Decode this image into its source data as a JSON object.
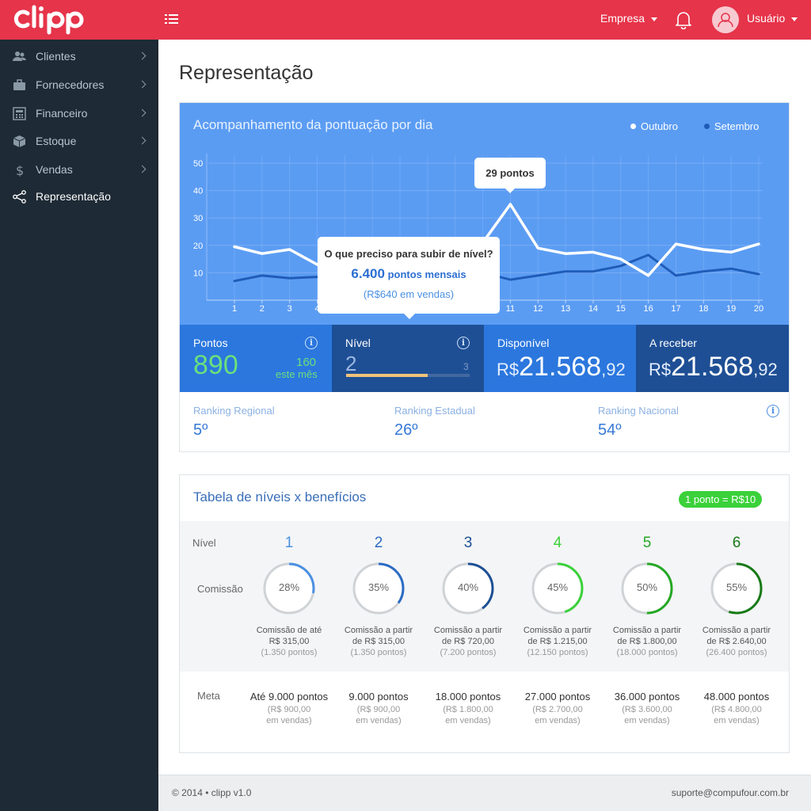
{
  "app": {
    "logo_text": "clipp"
  },
  "header": {
    "company_label": "Empresa",
    "user_label": "Usuário"
  },
  "sidebar": {
    "items": [
      {
        "label": "Clientes",
        "icon": "users-icon"
      },
      {
        "label": "Fornecedores",
        "icon": "briefcase-icon"
      },
      {
        "label": "Financeiro",
        "icon": "calculator-icon"
      },
      {
        "label": "Estoque",
        "icon": "box-icon"
      },
      {
        "label": "Vendas",
        "icon": "dollar-icon"
      },
      {
        "label": "Representação",
        "icon": "share-icon",
        "active": true
      }
    ]
  },
  "main": {
    "title": "Representação"
  },
  "chart_section": {
    "title": "Acompanhamento da pontuação por dia",
    "legend": [
      {
        "name": "Outubro",
        "color": "#ffffff"
      },
      {
        "name": "Setembro",
        "color": "#1f5cb8"
      }
    ],
    "tooltip_small": "29 pontos",
    "tooltip_big": {
      "question": "O que preciso para subir de nível?",
      "points_value": "6.400",
      "points_label": "pontos mensais",
      "sales": "(R$640 em vendas)"
    }
  },
  "chart_data": {
    "type": "line",
    "x": [
      1,
      2,
      3,
      4,
      5,
      6,
      7,
      8,
      9,
      10,
      11,
      12,
      13,
      14,
      15,
      16,
      17,
      18,
      19,
      20
    ],
    "ylim": [
      0,
      55
    ],
    "yticks": [
      10,
      20,
      30,
      40,
      50
    ],
    "series": [
      {
        "name": "Outubro",
        "color": "#ffffff",
        "values": [
          19.5,
          17,
          18.5,
          13,
          12,
          15,
          14,
          16,
          17,
          21,
          35,
          19,
          17,
          17.5,
          15,
          9,
          20.5,
          18.5,
          17.5,
          20.5
        ]
      },
      {
        "name": "Setembro",
        "color": "#1f5cb8",
        "values": [
          7,
          9,
          8,
          8.5,
          9,
          9.5,
          10,
          9,
          9.5,
          10,
          7.5,
          9,
          10.5,
          10.5,
          12.5,
          16.5,
          9,
          10.5,
          11.5,
          9.5
        ]
      }
    ]
  },
  "stats": {
    "pontos": {
      "title": "Pontos",
      "value": "890",
      "month_value": "160",
      "month_label": "este mês"
    },
    "nivel": {
      "title": "Nível",
      "value": "2",
      "max": "3",
      "progress": 0.66
    },
    "disponivel": {
      "title": "Disponível",
      "currency": "R$",
      "int": "21.568",
      "dec": ",92"
    },
    "a_receber": {
      "title": "A receber",
      "currency": "R$",
      "int": "21.568",
      "dec": ",92"
    }
  },
  "rankings": [
    {
      "label": "Ranking Regional",
      "value": "5º"
    },
    {
      "label": "Ranking Estadual",
      "value": "26º"
    },
    {
      "label": "Ranking Nacional",
      "value": "54º"
    }
  ],
  "levels_table": {
    "title": "Tabela de níveis x benefícios",
    "badge": "1 ponto = R$10",
    "row_labels": {
      "level": "Nível",
      "commission": "Comissão",
      "goal": "Meta"
    },
    "levels": [
      {
        "level": "1",
        "color": "#4a90e2",
        "percent": "28%",
        "fraction": 0.28,
        "desc1": "Comissão de até",
        "desc2": "R$ 315,00",
        "desc3": "(1.350 pontos)",
        "goal": "Até 9.000 pontos",
        "goal_sub1": "(R$ 900,00",
        "goal_sub2": "em vendas)"
      },
      {
        "level": "2",
        "color": "#2b6cc4",
        "percent": "35%",
        "fraction": 0.35,
        "desc1": "Comissão a partir",
        "desc2": "de R$ 315,00",
        "desc3": "(1.350 pontos)",
        "goal": "9.000 pontos",
        "goal_sub1": "(R$ 900,00",
        "goal_sub2": "em vendas)"
      },
      {
        "level": "3",
        "color": "#1d4f95",
        "percent": "40%",
        "fraction": 0.4,
        "desc1": "Comissão a partir",
        "desc2": "de R$ 720,00",
        "desc3": "(7.200 pontos)",
        "goal": "18.000 pontos",
        "goal_sub1": "(R$ 1.800,00",
        "goal_sub2": "em vendas)"
      },
      {
        "level": "4",
        "color": "#3ad13a",
        "percent": "45%",
        "fraction": 0.45,
        "desc1": "Comissão a partir",
        "desc2": "de R$ 1.215,00",
        "desc3": "(12.150 pontos)",
        "goal": "27.000 pontos",
        "goal_sub1": "(R$ 2.700,00",
        "goal_sub2": "em vendas)"
      },
      {
        "level": "5",
        "color": "#24a824",
        "percent": "50%",
        "fraction": 0.5,
        "desc1": "Comissão a partir",
        "desc2": "de R$ 1.800,00",
        "desc3": "(18.000 pontos)",
        "goal": "36.000 pontos",
        "goal_sub1": "(R$ 3.600,00",
        "goal_sub2": "em vendas)"
      },
      {
        "level": "6",
        "color": "#177a17",
        "percent": "55%",
        "fraction": 0.55,
        "desc1": "Comissão a partir",
        "desc2": "de R$ 2.640,00",
        "desc3": "(26.400 pontos)",
        "goal": "48.000 pontos",
        "goal_sub1": "(R$ 4.800,00",
        "goal_sub2": "em vendas)"
      }
    ]
  },
  "footer": {
    "copyright": "© 2014  •  clipp v1.0",
    "email": "suporte@compufour.com.br"
  }
}
